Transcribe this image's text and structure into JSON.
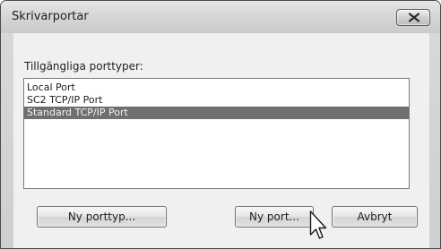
{
  "window": {
    "title": "Skrivarportar"
  },
  "dialog": {
    "available_label": "Tillgängliga porttyper:",
    "port_types": [
      {
        "label": "Local Port",
        "selected": false
      },
      {
        "label": "SC2 TCP/IP Port",
        "selected": false
      },
      {
        "label": "Standard TCP/IP Port",
        "selected": true
      }
    ]
  },
  "buttons": {
    "new_port_type": "Ny porttyp...",
    "new_port": "Ny port...",
    "cancel": "Avbryt"
  },
  "icons": {
    "close": "close-icon",
    "cursor": "mouse-pointer-icon"
  },
  "colors": {
    "selection": "#6f6f6f",
    "dialog_bg": "#f0f0f0"
  }
}
